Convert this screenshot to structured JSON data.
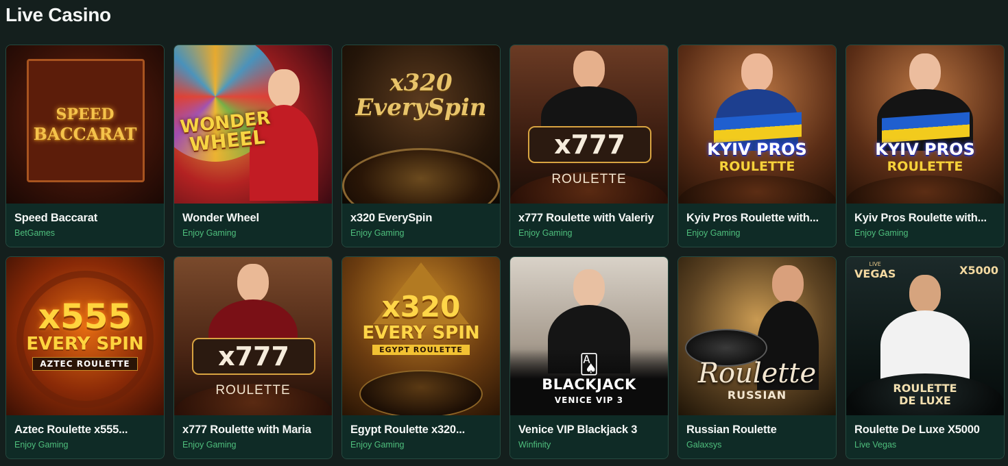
{
  "page": {
    "title": "Live Casino"
  },
  "games": [
    {
      "title": "Speed Baccarat",
      "provider": "BetGames",
      "art": [
        "SPEED",
        "BACCARAT"
      ]
    },
    {
      "title": "Wonder Wheel",
      "provider": "Enjoy Gaming",
      "art": [
        "WONDER",
        "WHEEL"
      ]
    },
    {
      "title": "x320 EverySpin",
      "provider": "Enjoy Gaming",
      "art": [
        "x320",
        "EverySpin"
      ]
    },
    {
      "title": "x777 Roulette with Valeriy",
      "provider": "Enjoy Gaming",
      "art": [
        "x777",
        "ROULETTE"
      ]
    },
    {
      "title": "Kyiv Pros Roulette with...",
      "provider": "Enjoy Gaming",
      "art": [
        "KYIV PROS",
        "ROULETTE"
      ]
    },
    {
      "title": "Kyiv Pros Roulette with...",
      "provider": "Enjoy Gaming",
      "art": [
        "KYIV PROS",
        "ROULETTE"
      ]
    },
    {
      "title": "Aztec Roulette x555...",
      "provider": "Enjoy Gaming",
      "art": [
        "x555",
        "EVERY SPIN",
        "AZTEC ROULETTE"
      ]
    },
    {
      "title": "x777 Roulette with Maria",
      "provider": "Enjoy Gaming",
      "art": [
        "x777",
        "ROULETTE"
      ]
    },
    {
      "title": "Egypt Roulette x320...",
      "provider": "Enjoy Gaming",
      "art": [
        "x320",
        "EVERY SPIN",
        "EGYPT ROULETTE"
      ]
    },
    {
      "title": "Venice VIP Blackjack 3",
      "provider": "Winfinity",
      "art": [
        "BLACKJACK",
        "VENICE VIP 3"
      ]
    },
    {
      "title": "Russian Roulette",
      "provider": "Galaxsys",
      "art": [
        "Roulette",
        "RUSSIAN"
      ]
    },
    {
      "title": "Roulette De Luxe X5000",
      "provider": "Live Vegas",
      "art": [
        "ROULETTE",
        "DE LUXE",
        "X5000",
        "VEGAS",
        "LIVE"
      ]
    }
  ],
  "colors": {
    "background": "#141f1d",
    "card": "#0f2b26",
    "provider": "#4fbf7d",
    "border": "#254a40"
  }
}
